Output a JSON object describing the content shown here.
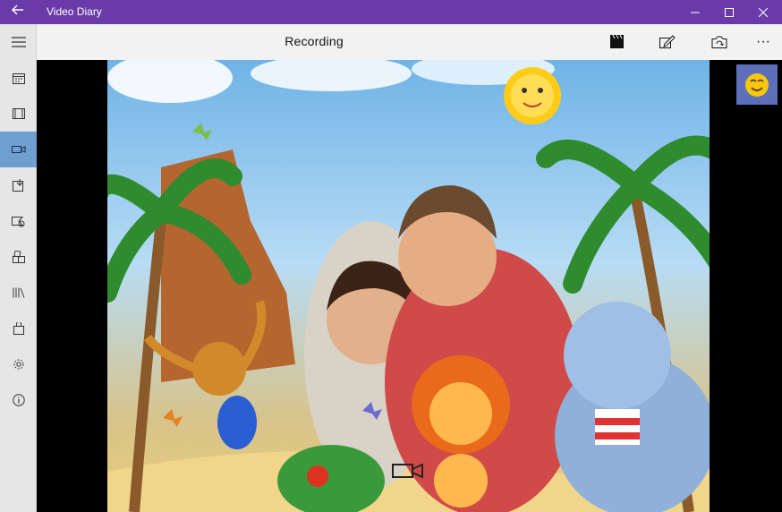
{
  "window": {
    "title": "Video Diary",
    "back_icon": "back-arrow-icon",
    "controls": [
      "minimize-icon",
      "maximize-icon",
      "close-icon"
    ]
  },
  "command_bar": {
    "title": "Recording",
    "actions": [
      "clapperboard-icon",
      "edit-icon",
      "camera-switch-icon",
      "more-icon"
    ],
    "more_label": "···"
  },
  "sidebar": {
    "items": [
      {
        "icon": "hamburger-menu-icon",
        "active": false
      },
      {
        "icon": "calendar-icon",
        "active": false
      },
      {
        "icon": "film-icon",
        "active": false
      },
      {
        "icon": "video-camera-icon",
        "active": true
      },
      {
        "icon": "import-icon",
        "active": false
      },
      {
        "icon": "tag-icon",
        "active": false
      },
      {
        "icon": "apps-icon",
        "active": false
      },
      {
        "icon": "library-icon",
        "active": false
      },
      {
        "icon": "store-bag-icon",
        "active": false
      },
      {
        "icon": "settings-gear-icon",
        "active": false
      },
      {
        "icon": "info-icon",
        "active": false
      }
    ]
  },
  "camera_preview": {
    "description_icon": "camera-preview-with-cartoon-frame",
    "record_icon": "video-record-icon",
    "emoji_icon": "smiley-emoji-icon"
  },
  "colors": {
    "titlebar": "#6a3aa8",
    "sidebar_active": "#6f9fd1",
    "emoji_button": "#5c6fb8"
  }
}
